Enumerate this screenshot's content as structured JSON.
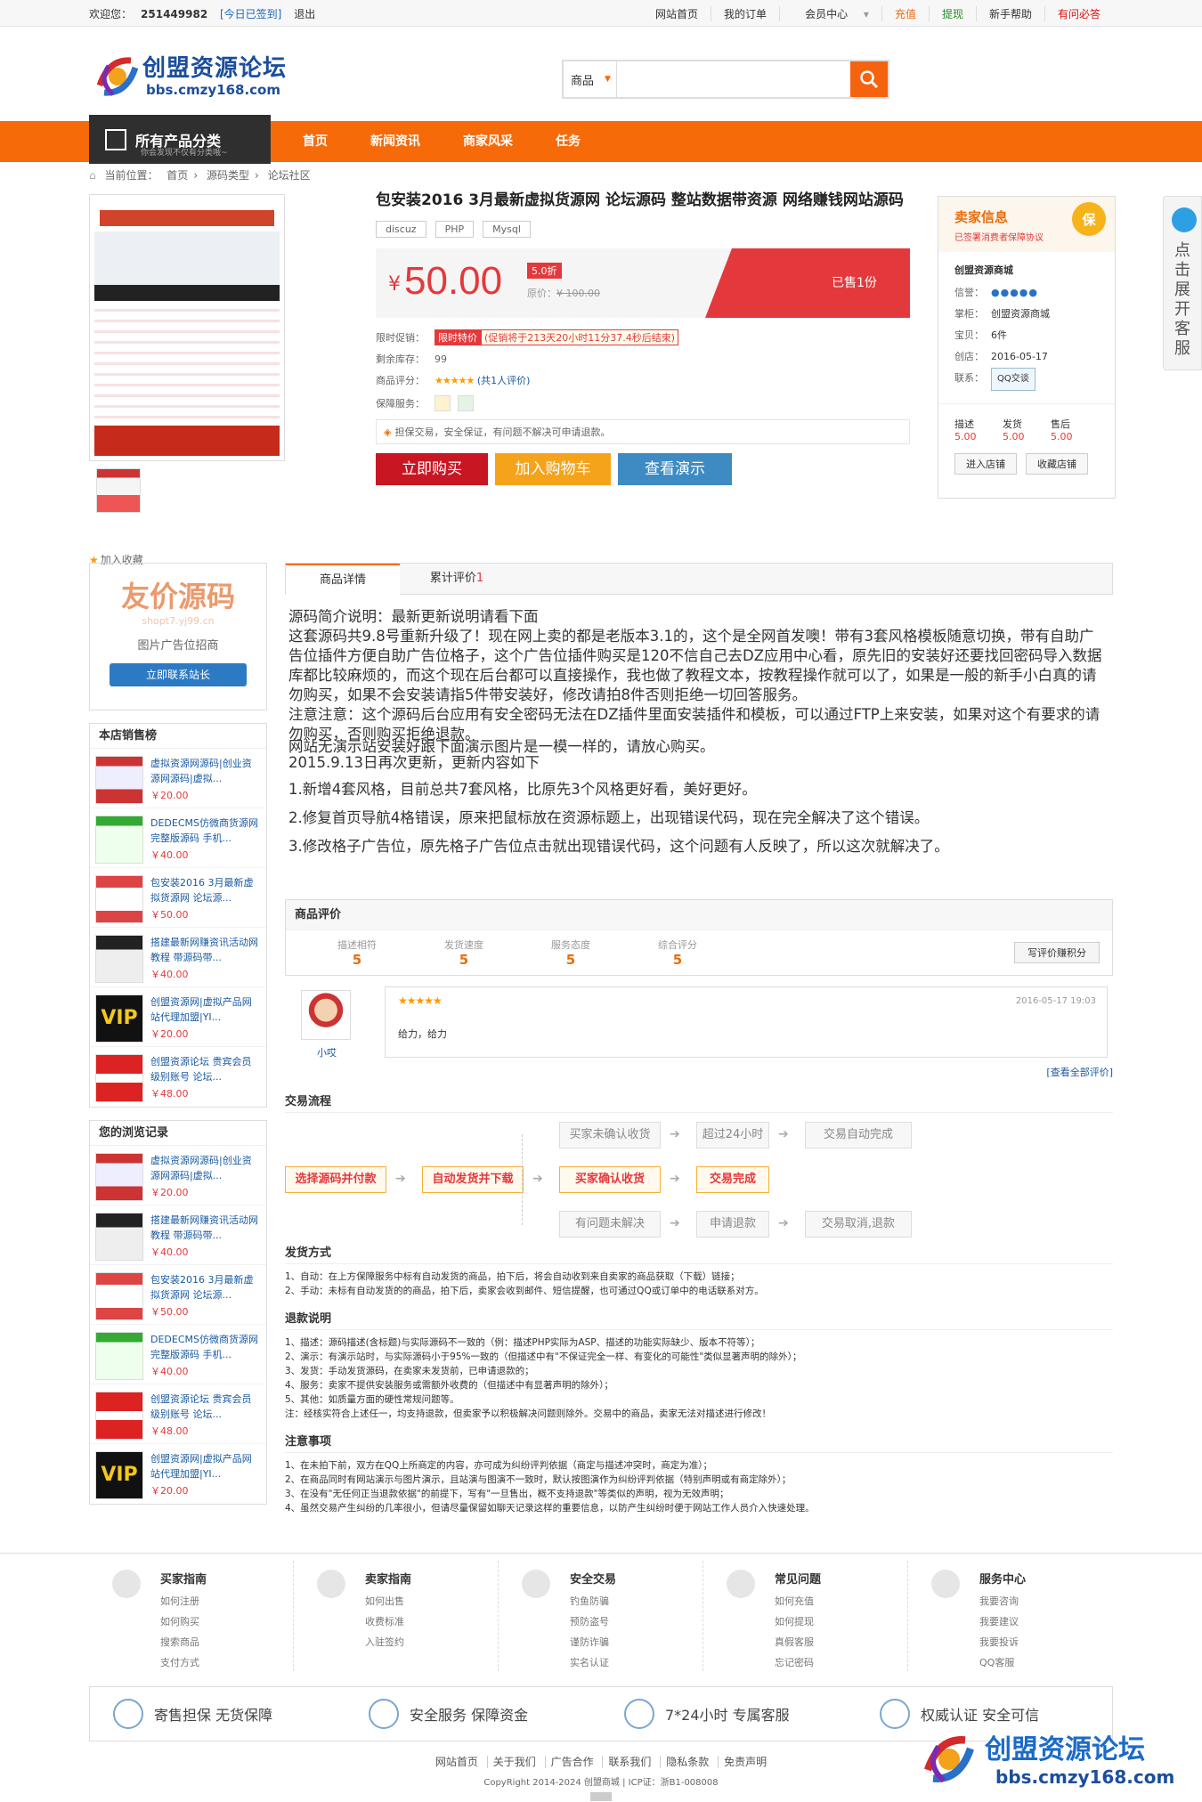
{
  "topbar": {
    "welcome": "欢迎您：",
    "uid": "251449982",
    "signin": "[今日已签到]",
    "logout": "退出",
    "links": [
      "网站首页",
      "我的订单",
      "会员中心",
      "充值",
      "提现",
      "新手帮助",
      "有问必答"
    ]
  },
  "logo": {
    "name": "创盟资源论坛",
    "domain": "bbs.cmzy168.com"
  },
  "search": {
    "category": "商品",
    "placeholder": ""
  },
  "nav": {
    "allcat": "所有产品分类",
    "allcat_sub": "你会发现不仅有分类哦~",
    "links": [
      "首页",
      "新闻资讯",
      "商家风采",
      "任务"
    ]
  },
  "crumb": {
    "label": "当前位置：",
    "items": [
      "首页",
      "源码类型",
      "论坛社区"
    ]
  },
  "product": {
    "title": "包安装2016 3月最新虚拟货源网 论坛源码 整站数据带资源 网络赚钱网站源码",
    "tags": [
      "discuz",
      "PHP",
      "Mysql"
    ],
    "currency": "¥",
    "price": "50.00",
    "discount": "5.0折",
    "orig_label": "原价：",
    "orig_price": "¥ 100.00",
    "sold": "已售1份",
    "promo_label": "限时促销：",
    "promo_tag": "限时特价",
    "promo_time": "(促销将于213天20小时11分37.4秒后结束)",
    "stock_label": "剩余库存：",
    "stock": "99",
    "score_label": "商品评分：",
    "score_count": "(共1人评价)",
    "guarantee_label": "保障服务：",
    "guarantee_note": "担保交易，安全保证，有问题不解决可申请退款。",
    "buy": "立即购买",
    "cart": "加入购物车",
    "demo": "查看演示",
    "fav": "加入收藏"
  },
  "seller": {
    "title": "卖家信息",
    "sub": "已签署消费者保障协议",
    "badge": "保",
    "shop": "创盟资源商城",
    "credit_k": "信誉：",
    "owner_k": "掌柜：",
    "owner": "创盟资源商城",
    "items_k": "宝贝：",
    "items": "6件",
    "created_k": "创店：",
    "created": "2016-05-17",
    "contact_k": "联系：",
    "qq": "QQ交谈",
    "scores": [
      {
        "k": "描述",
        "v": "5.00"
      },
      {
        "k": "发货",
        "v": "5.00"
      },
      {
        "k": "售后",
        "v": "5.00"
      }
    ],
    "enter": "进入店铺",
    "collect": "收藏店铺"
  },
  "float": {
    "text": [
      "点",
      "击",
      "展",
      "开",
      "客",
      "服"
    ]
  },
  "ad": {
    "title": "友价源码",
    "domain": "shopt7.yj99.cn",
    "text": "图片广告位招商",
    "btn": "立即联系站长"
  },
  "hot": {
    "title": "本店销售榜",
    "items": [
      {
        "t": "虚拟资源网源码|创业资源网源码|虚拟...",
        "p": "￥20.00"
      },
      {
        "t": "DEDECMS仿微商货源网完整版源码 手机...",
        "p": "￥40.00"
      },
      {
        "t": "包安装2016 3月最新虚拟货源网 论坛源...",
        "p": "￥50.00"
      },
      {
        "t": "搭建最新网赚资讯活动网教程 带源码带...",
        "p": "￥40.00"
      },
      {
        "t": "创盟资源网|虚拟产品网站代理加盟|YI...",
        "p": "￥20.00"
      },
      {
        "t": "创盟资源论坛 贵宾会员级别账号 论坛...",
        "p": "￥48.00"
      }
    ]
  },
  "history": {
    "title": "您的浏览记录",
    "items": [
      {
        "t": "虚拟资源网源码|创业资源网源码|虚拟...",
        "p": "￥20.00"
      },
      {
        "t": "搭建最新网赚资讯活动网教程 带源码带...",
        "p": "￥40.00"
      },
      {
        "t": "包安装2016 3月最新虚拟货源网 论坛源...",
        "p": "￥50.00"
      },
      {
        "t": "DEDECMS仿微商货源网完整版源码 手机...",
        "p": "￥40.00"
      },
      {
        "t": "创盟资源论坛 贵宾会员级别账号 论坛...",
        "p": "￥48.00"
      },
      {
        "t": "创盟资源网|虚拟产品网站代理加盟|YI...",
        "p": "￥20.00"
      }
    ]
  },
  "tabs": {
    "detail": "商品详情",
    "reviews": "累计评价",
    "count": "1"
  },
  "desc": [
    "源码简介说明：最新更新说明请看下面",
    "这套源码共9.8号重新升级了！现在网上卖的都是老版本3.1的，这个是全网首发噢！带有3套风格模板随意切换，带有自助广告位插件方便自助广告位格子，这个广告位插件购买是120不信自己去DZ应用中心看，原先旧的安装好还要找回密码导入数据库都比较麻烦的，而这个现在后台都可以直接操作，我也做了教程文本，按教程操作就可以了，如果是一般的新手小白真的请勿购买，如果不会安装请指5件带安装好，修改请拍8件否则拒绝一切回答服务。",
    "注意注意：这个源码后台应用有安全密码无法在DZ插件里面安装插件和模板，可以通过FTP上来安装，如果对这个有要求的请勿购买，否则购买拒绝退款。",
    "网站无演示站安装好跟下面演示图片是一模一样的，请放心购买。",
    "2015.9.13日再次更新，更新内容如下",
    "1.新增4套风格，目前总共7套风格，比原先3个风格更好看，美好更好。",
    " 2.修复首页导航4格错误，原来把鼠标放在资源标题上，出现错误代码，现在完全解决了这个错误。",
    "3.修改格子广告位，原先格子广告位点击就出现错误代码，这个问题有人反映了，所以这次就解决了。"
  ],
  "rating": {
    "title": "商品评价",
    "items": [
      {
        "k": "描述相符",
        "v": "5"
      },
      {
        "k": "发货速度",
        "v": "5"
      },
      {
        "k": "服务态度",
        "v": "5"
      },
      {
        "k": "综合评分",
        "v": "5"
      }
    ],
    "write": "写评价赚积分",
    "user": "小哎",
    "time": "2016-05-17 19:03",
    "text": "给力，给力",
    "all": "[查看全部评价]"
  },
  "flow": {
    "title": "交易流程",
    "boxes": [
      "选择源码并付款",
      "自动发货并下载",
      "买家确认收货",
      "交易完成",
      "买家未确认收货",
      "超过24小时",
      "交易自动完成",
      "有问题未解决",
      "申请退款",
      "交易取消,退款"
    ]
  },
  "ship": {
    "title": "发货方式",
    "lines": [
      "1、自动：在上方保障服务中标有自动发货的商品，拍下后，将会自动收到来自卖家的商品获取（下载）链接；",
      "2、手动：未标有自动发货的的商品，拍下后，卖家会收到邮件、短信提醒，也可通过QQ或订单中的电话联系对方。"
    ]
  },
  "refund": {
    "title": "退款说明",
    "lines": [
      "1、描述：源码描述(含标题)与实际源码不一致的（例：描述PHP实际为ASP、描述的功能实际缺少、版本不符等）；",
      "2、演示：有演示站时，与实际源码小于95%一致的（但描述中有\"不保证完全一样、有变化的可能性\"类似显著声明的除外）；",
      "3、发货：手动发货源码，在卖家未发货前，已申请退款的；",
      "4、服务：卖家不提供安装服务或需额外收费的（但描述中有显著声明的除外）；",
      "5、其他：如质量方面的硬性常规问题等。",
      "注：经核实符合上述任一，均支持退款，但卖家予以积极解决问题则除外。交易中的商品，卖家无法对描述进行修改！"
    ]
  },
  "notice": {
    "title": "注意事项",
    "lines": [
      "1、在未拍下前，双方在QQ上所商定的内容，亦可成为纠纷评判依据（商定与描述冲突时，商定为准）；",
      "2、在商品同时有网站演示与图片演示，且站演与图演不一致时，默认按图演作为纠纷评判依据（特别声明或有商定除外）；",
      "3、在没有\"无任何正当退款依据\"的前提下，写有\"一旦售出，概不支持退款\"等类似的声明，视为无效声明；",
      "4、虽然交易产生纠纷的几率很小，但请尽量保留如聊天记录这样的重要信息，以防产生纠纷时便于网站工作人员介入快速处理。"
    ]
  },
  "guide": [
    {
      "t": "买家指南",
      "ls": [
        "如何注册",
        "如何购买",
        "搜索商品",
        "支付方式"
      ]
    },
    {
      "t": "卖家指南",
      "ls": [
        "如何出售",
        "收费标准",
        "入驻签约"
      ]
    },
    {
      "t": "安全交易",
      "ls": [
        "钓鱼防骗",
        "预防盗号",
        "谨防诈骗",
        "实名认证"
      ]
    },
    {
      "t": "常见问题",
      "ls": [
        "如何充值",
        "如何提现",
        "真假客服",
        "忘记密码"
      ]
    },
    {
      "t": "服务中心",
      "ls": [
        "我要咨询",
        "我要建议",
        "我要投诉",
        "QQ客服"
      ]
    }
  ],
  "service": [
    "寄售担保  无货保障",
    "安全服务  保障资金",
    "7*24小时  专属客服",
    "权威认证  安全可信"
  ],
  "flinks": [
    "网站首页",
    "关于我们",
    "广告合作",
    "联系我们",
    "隐私条款",
    "免责声明"
  ],
  "copy": "CopyRight 2014-2024 创盟商城 | ICP证：浙B1-008008"
}
